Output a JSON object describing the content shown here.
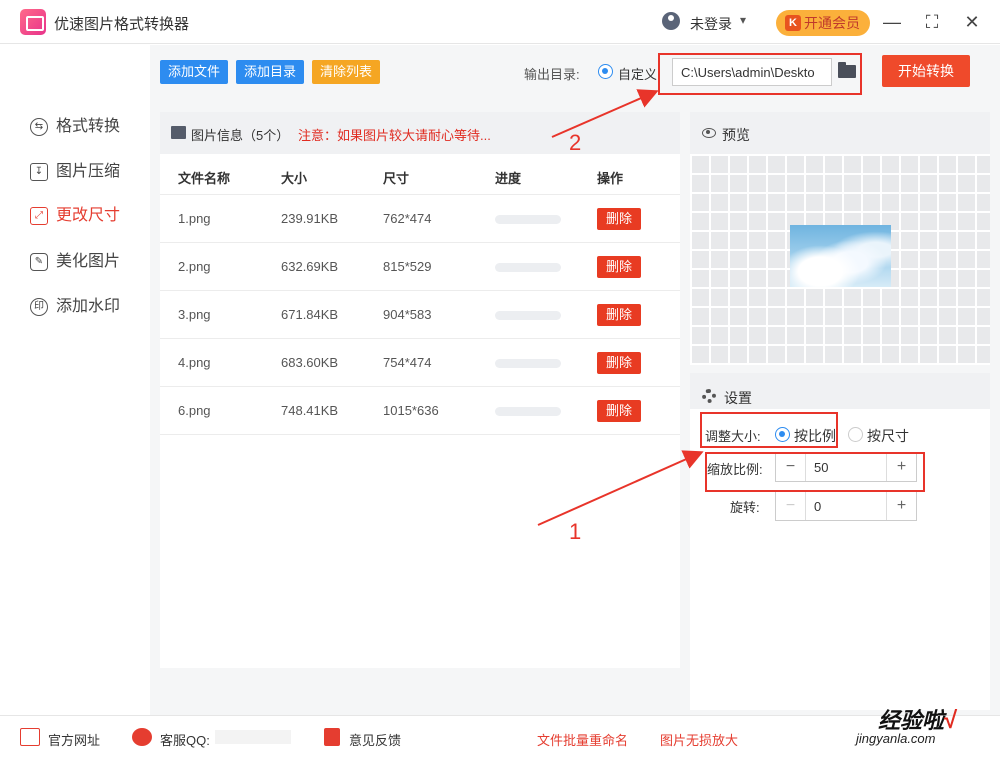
{
  "app": {
    "title": "优速图片格式转换器",
    "login_text": "未登录",
    "vip_label": "开通会员",
    "vip_icon_letter": "K"
  },
  "window_controls": {
    "minimize": "—",
    "maximize": "⛶",
    "close": "✕"
  },
  "sidebar": {
    "items": [
      {
        "label": "格式转换",
        "icon": "convert-icon",
        "active": false
      },
      {
        "label": "图片压缩",
        "icon": "compress-icon",
        "active": false
      },
      {
        "label": "更改尺寸",
        "icon": "resize-icon",
        "active": true
      },
      {
        "label": "美化图片",
        "icon": "beautify-icon",
        "active": false
      },
      {
        "label": "添加水印",
        "icon": "watermark-icon",
        "active": false
      }
    ]
  },
  "toolbar": {
    "add_file": "添加文件",
    "add_folder": "添加目录",
    "clear_list": "清除列表",
    "output_label": "输出目录:",
    "custom_label": "自定义",
    "output_path": "C:\\Users\\admin\\Deskto",
    "start_button": "开始转换",
    "colors": {
      "add": "#2d8cf0",
      "clear": "#f5a623",
      "start": "#ef4a2b"
    }
  },
  "file_panel": {
    "info": "图片信息（5个）",
    "note": "注意：如果图片较大请耐心等待...",
    "columns": [
      "文件名称",
      "大小",
      "尺寸",
      "进度",
      "操作"
    ],
    "delete_label": "删除",
    "rows": [
      {
        "name": "1.png",
        "size": "239.91KB",
        "dims": "762*474",
        "progress": 0
      },
      {
        "name": "2.png",
        "size": "632.69KB",
        "dims": "815*529",
        "progress": 0
      },
      {
        "name": "3.png",
        "size": "671.84KB",
        "dims": "904*583",
        "progress": 0
      },
      {
        "name": "4.png",
        "size": "683.60KB",
        "dims": "754*474",
        "progress": 0
      },
      {
        "name": "6.png",
        "size": "748.41KB",
        "dims": "1015*636",
        "progress": 0
      }
    ]
  },
  "preview": {
    "title": "预览"
  },
  "settings": {
    "title": "设置",
    "resize_label": "调整大小:",
    "by_ratio": "按比例",
    "by_size": "按尺寸",
    "scale_label": "缩放比例:",
    "scale_value": "50",
    "rotate_label": "旋转:",
    "rotate_value": "0",
    "minus": "−",
    "plus": "+"
  },
  "annotations": {
    "num1": "1",
    "num2": "2",
    "color": "#e8342a"
  },
  "footer": {
    "website": "官方网址",
    "qq": "客服QQ:",
    "feedback": "意见反馈",
    "batch_rename": "文件批量重命名",
    "lossless_enlarge": "图片无损放大"
  },
  "watermark": {
    "cn": "经验啦",
    "check": "√",
    "en": "jingyanla.com"
  }
}
